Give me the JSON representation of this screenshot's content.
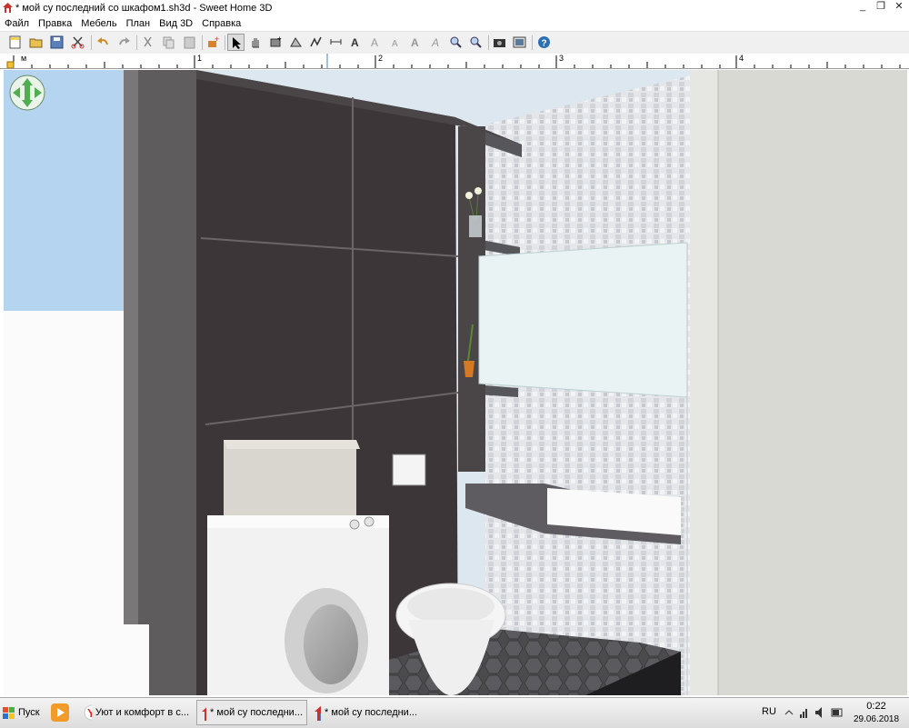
{
  "window": {
    "title": "* мой су последний со шкафом1.sh3d - Sweet Home 3D"
  },
  "menu": [
    "Файл",
    "Правка",
    "Мебель",
    "План",
    "Вид 3D",
    "Справка"
  ],
  "toolbar": {
    "buttons": [
      "new-home",
      "open",
      "save",
      "cut-preferences",
      "undo",
      "redo",
      "cut",
      "copy",
      "paste",
      "add-furniture",
      "select-mode",
      "pan-mode",
      "create-walls",
      "create-rooms",
      "create-polylines",
      "create-dimensions",
      "add-text",
      "increase-text",
      "decrease-text",
      "bold-text",
      "italic-text",
      "zoom-in",
      "zoom-out",
      "create-photo",
      "create-video",
      "help"
    ]
  },
  "ruler": {
    "unit": "м",
    "marks": [
      "1",
      "2",
      "3",
      "4"
    ]
  },
  "viewport": {
    "description_icon": "navigation-arrows-icon"
  },
  "taskbar": {
    "start_label": "Пуск",
    "tasks": [
      {
        "label": "",
        "icon": "media-player-icon"
      },
      {
        "label": "Уют и комфорт в с...",
        "icon": "yandex-browser-icon"
      },
      {
        "label": "* мой су последни...",
        "icon": "sweet-home-icon",
        "active": true
      },
      {
        "label": "* мой су последни...",
        "icon": "sweet-home-icon"
      }
    ],
    "tray": {
      "lang": "RU",
      "time": "0:22",
      "date": "29.06.2018"
    }
  },
  "colors": {
    "accent": "#2b6fb5",
    "toolbar_bg": "#f0f0f0"
  }
}
